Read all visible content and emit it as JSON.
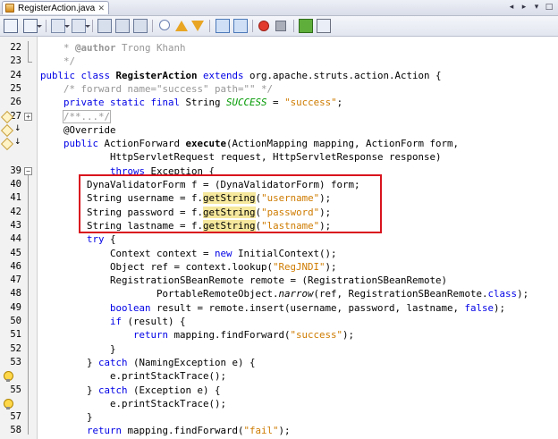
{
  "tab": {
    "title": "RegisterAction.java"
  },
  "tab_controls": {
    "left": "◂",
    "right": "▸",
    "list": "▾",
    "max": "□"
  },
  "lines": [
    {
      "n": "22",
      "parts": [
        {
          "t": "    * ",
          "c": "cm"
        },
        {
          "t": "@author",
          "c": "cm-b"
        },
        {
          "t": " Trong Khanh",
          "c": "cm"
        }
      ]
    },
    {
      "n": "23",
      "parts": [
        {
          "t": "    */",
          "c": "cm"
        }
      ]
    },
    {
      "n": "24",
      "parts": [
        {
          "t": "public class ",
          "c": "kw"
        },
        {
          "t": "RegisterAction",
          "c": "cls-bold"
        },
        {
          "t": " extends ",
          "c": "kw"
        },
        {
          "t": "org.apache.struts.action.Action {",
          "c": ""
        }
      ]
    },
    {
      "n": "25",
      "parts": [
        {
          "t": "    /* forward name=\"success\" path=\"\" */",
          "c": "cm"
        }
      ]
    },
    {
      "n": "26",
      "parts": [
        {
          "t": "    private static final ",
          "c": "kw"
        },
        {
          "t": "String ",
          "c": ""
        },
        {
          "t": "SUCCESS",
          "c": "const"
        },
        {
          "t": " = ",
          "c": ""
        },
        {
          "t": "\"success\"",
          "c": "st"
        },
        {
          "t": ";",
          "c": ""
        }
      ]
    },
    {
      "n": "27",
      "parts": [
        {
          "t": "    ",
          "c": ""
        },
        {
          "t": "/**...*/",
          "c": "cm fold-box"
        }
      ]
    },
    {
      "n": "",
      "parts": [
        {
          "t": "    @Override",
          "c": ""
        }
      ]
    },
    {
      "n": "",
      "parts": [
        {
          "t": "    public ",
          "c": "kw"
        },
        {
          "t": "ActionForward ",
          "c": ""
        },
        {
          "t": "execute",
          "c": "cls-bold"
        },
        {
          "t": "(ActionMapping mapping, ActionForm form,",
          "c": ""
        }
      ]
    },
    {
      "n": "",
      "parts": [
        {
          "t": "            HttpServletRequest request, HttpServletResponse response)",
          "c": ""
        }
      ]
    },
    {
      "n": "39",
      "parts": [
        {
          "t": "            ",
          "c": ""
        },
        {
          "t": "throws ",
          "c": "kw"
        },
        {
          "t": "Exception {",
          "c": ""
        }
      ]
    },
    {
      "n": "40",
      "parts": [
        {
          "t": "        DynaValidatorForm f = (DynaValidatorForm) form;",
          "c": ""
        }
      ]
    },
    {
      "n": "41",
      "parts": [
        {
          "t": "        String username = ",
          "c": ""
        },
        {
          "t": "f.",
          "c": ""
        },
        {
          "t": "getString",
          "c": "hl"
        },
        {
          "t": "(",
          "c": ""
        },
        {
          "t": "\"username\"",
          "c": "st"
        },
        {
          "t": ");",
          "c": ""
        }
      ]
    },
    {
      "n": "42",
      "parts": [
        {
          "t": "        String password = ",
          "c": ""
        },
        {
          "t": "f.",
          "c": ""
        },
        {
          "t": "getString",
          "c": "hl"
        },
        {
          "t": "(",
          "c": ""
        },
        {
          "t": "\"password\"",
          "c": "st"
        },
        {
          "t": ");",
          "c": ""
        }
      ]
    },
    {
      "n": "43",
      "parts": [
        {
          "t": "        String lastname = ",
          "c": ""
        },
        {
          "t": "f.",
          "c": ""
        },
        {
          "t": "getString",
          "c": "hl"
        },
        {
          "t": "(",
          "c": ""
        },
        {
          "t": "\"lastname\"",
          "c": "st"
        },
        {
          "t": ");",
          "c": ""
        }
      ]
    },
    {
      "n": "44",
      "parts": [
        {
          "t": "        try ",
          "c": "kw"
        },
        {
          "t": "{",
          "c": ""
        }
      ]
    },
    {
      "n": "45",
      "parts": [
        {
          "t": "            Context context = ",
          "c": ""
        },
        {
          "t": "new ",
          "c": "kw"
        },
        {
          "t": "InitialContext();",
          "c": ""
        }
      ]
    },
    {
      "n": "46",
      "parts": [
        {
          "t": "            Object ref = context.lookup(",
          "c": ""
        },
        {
          "t": "\"RegJNDI\"",
          "c": "st"
        },
        {
          "t": ");",
          "c": ""
        }
      ]
    },
    {
      "n": "47",
      "parts": [
        {
          "t": "            RegistrationSBeanRemote remote = (RegistrationSBeanRemote)",
          "c": ""
        }
      ]
    },
    {
      "n": "48",
      "parts": [
        {
          "t": "                    PortableRemoteObject.",
          "c": ""
        },
        {
          "t": "narrow",
          "c": "it"
        },
        {
          "t": "(ref, RegistrationSBeanRemote.",
          "c": ""
        },
        {
          "t": "class",
          "c": "kw"
        },
        {
          "t": ");",
          "c": ""
        }
      ]
    },
    {
      "n": "49",
      "parts": [
        {
          "t": "            boolean ",
          "c": "kw"
        },
        {
          "t": "result = remote.insert(username, password, lastname, ",
          "c": ""
        },
        {
          "t": "false",
          "c": "kw"
        },
        {
          "t": ");",
          "c": ""
        }
      ]
    },
    {
      "n": "50",
      "parts": [
        {
          "t": "            if ",
          "c": "kw"
        },
        {
          "t": "(result) {",
          "c": ""
        }
      ]
    },
    {
      "n": "51",
      "parts": [
        {
          "t": "                return ",
          "c": "kw"
        },
        {
          "t": "mapping.findForward(",
          "c": ""
        },
        {
          "t": "\"success\"",
          "c": "st"
        },
        {
          "t": ");",
          "c": ""
        }
      ]
    },
    {
      "n": "52",
      "parts": [
        {
          "t": "            }",
          "c": ""
        }
      ]
    },
    {
      "n": "53",
      "parts": [
        {
          "t": "        } ",
          "c": ""
        },
        {
          "t": "catch ",
          "c": "kw"
        },
        {
          "t": "(NamingException e) {",
          "c": ""
        }
      ]
    },
    {
      "n": "",
      "parts": [
        {
          "t": "            e.printStackTrace();",
          "c": ""
        }
      ]
    },
    {
      "n": "55",
      "parts": [
        {
          "t": "        } ",
          "c": ""
        },
        {
          "t": "catch ",
          "c": "kw"
        },
        {
          "t": "(Exception e) {",
          "c": ""
        }
      ]
    },
    {
      "n": "",
      "parts": [
        {
          "t": "            e.printStackTrace();",
          "c": ""
        }
      ]
    },
    {
      "n": "57",
      "parts": [
        {
          "t": "        }",
          "c": ""
        }
      ]
    },
    {
      "n": "58",
      "parts": [
        {
          "t": "        return ",
          "c": "kw"
        },
        {
          "t": "mapping.findForward(",
          "c": ""
        },
        {
          "t": "\"fail\"",
          "c": "st"
        },
        {
          "t": ");",
          "c": ""
        }
      ]
    }
  ],
  "toolbar_icons": [
    "source-icon",
    "history-icon",
    "back-icon",
    "forward-icon",
    "find-icon",
    "find-prev-icon",
    "find-next-icon",
    "toggle-highlight-icon",
    "prev-bookmark-icon",
    "next-bookmark-icon",
    "toggle-bookmark-icon",
    "shift-left-icon",
    "shift-right-icon",
    "record-macro-icon",
    "stop-macro-icon",
    "comment-icon",
    "uncomment-icon"
  ],
  "colors": {
    "keyword": "#0000e6",
    "comment": "#969696",
    "string": "#ce7b00",
    "highlight": "#f6e89c",
    "annotation_box": "#d9141e"
  }
}
